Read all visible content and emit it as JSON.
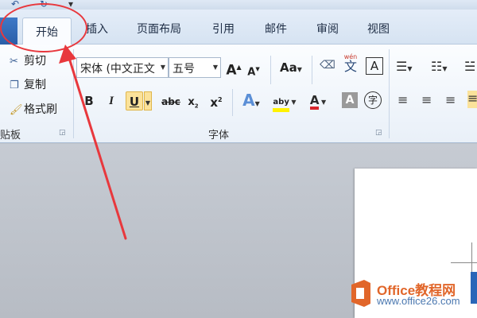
{
  "tabs": {
    "active": "开始",
    "items": [
      "插入",
      "页面布局",
      "引用",
      "邮件",
      "审阅",
      "视图"
    ]
  },
  "clipboard": {
    "cut": "剪切",
    "copy": "复制",
    "format_painter": "格式刷",
    "group_label": "贴板"
  },
  "font": {
    "family": "宋体 (中文正文",
    "size": "五号",
    "group_label": "字体",
    "buttons": {
      "bold": "B",
      "italic": "I",
      "underline": "U",
      "strike": "abc",
      "grow": "A",
      "shrink": "A",
      "change_case": "Aa",
      "pinyin": "文",
      "pinyin_top": "wén",
      "border": "A",
      "highlight": "aby",
      "color": "A",
      "shading": "A",
      "enclose": "字"
    }
  },
  "watermark": {
    "brand": "Office教程网",
    "url": "www.office26.com"
  },
  "colors": {
    "annotation": "#e8383d",
    "active_button": "#fbe29a",
    "font_color": "#d8262c",
    "highlight": "#fff200"
  }
}
